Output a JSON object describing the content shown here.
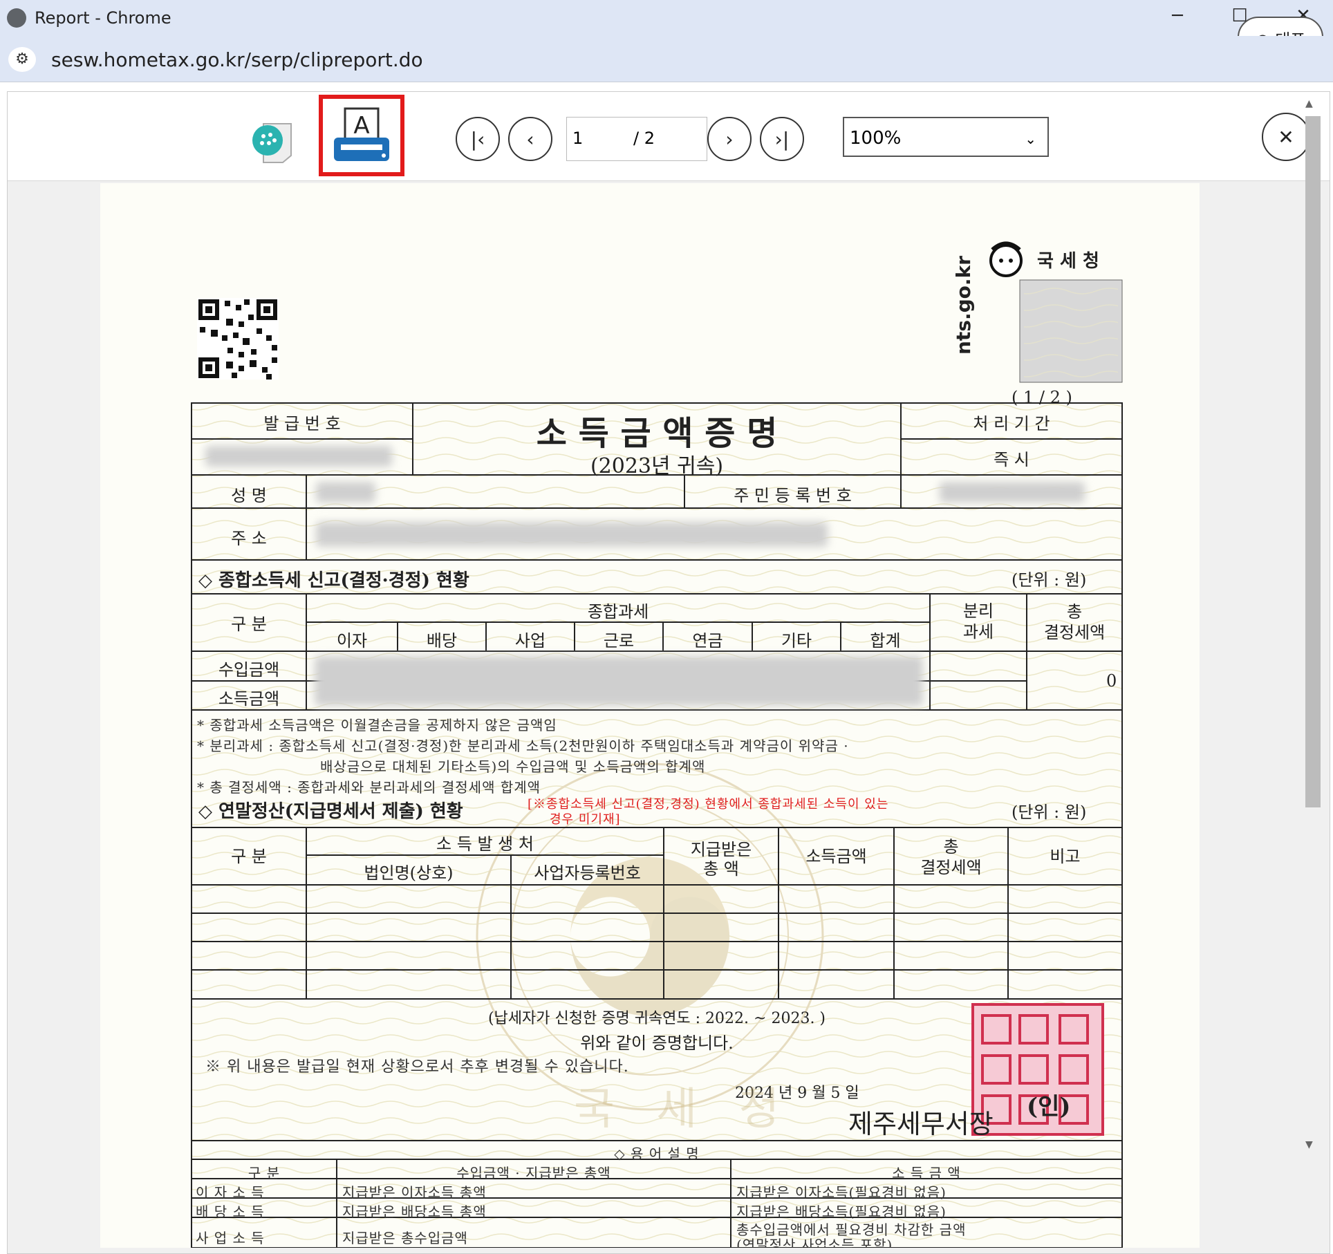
{
  "window": {
    "title": "Report - Chrome",
    "minimize": "─",
    "maximize": "☐",
    "close": "✕"
  },
  "profile_pill": "○ 대표",
  "address": {
    "url": "sesw.hometax.go.kr/serp/clipreport.do",
    "tune_icon": "tune-icon"
  },
  "toolbar": {
    "first": "|‹",
    "prev": "‹",
    "next": "›",
    "last": "›|",
    "page_current": "1",
    "page_total": "/ 2",
    "zoom": "100%",
    "zoom_caret": "⌄",
    "close": "✕"
  },
  "doc": {
    "nts_label": "국 세 청",
    "nts_url": "nts.go.kr",
    "page_indicator": "( 1   /   2 )",
    "issue_no_label": "발 급 번 호",
    "title": "소  득  금  액  증  명",
    "subtitle": "(2023년 귀속)",
    "period_label": "처 리 기 간",
    "period_value": "즉    시",
    "name_label": "성    명",
    "rrn_label": "주 민 등 록 번 호",
    "address_label": "주    소",
    "section1": {
      "title": "◇ 종합소득세 신고(결정·경정) 현황",
      "unit": "(단위 : 원)",
      "col_gubun": "구 분",
      "group_label": "종합과세",
      "sub_cols": [
        "이자",
        "배당",
        "사업",
        "근로",
        "연금",
        "기타",
        "합계"
      ],
      "col_separate": "분리\n과세",
      "col_total_tax_line1": "총",
      "col_total_tax_line2": "결정세액",
      "row1_label": "수입금액",
      "row2_label": "소득금액",
      "total_tax_value": "0",
      "notes": [
        "* 종합과세 소득금액은 이월결손금을 공제하지 않은 금액임",
        "* 분리과세 : 종합소득세 신고(결정·경정)한 분리과세 소득(2천만원이하 주택임대소득과 계약금이 위약금 ·",
        "배상금으로 대체된 기타소득)의 수입금액 및 소득금액의 합계액",
        "* 총 결정세액 : 종합과세와 분리과세의 결정세액 합계액"
      ]
    },
    "section2": {
      "title": "◇ 연말정산(지급명세서 제출) 현황",
      "red_note_line1": "[※종합소득세 신고(결정,경정) 현황에서 종합과세된 소득이 있는",
      "red_note_line2": "경우 미기재]",
      "unit": "(단위 : 원)",
      "col_gubun": "구 분",
      "group_label": "소 득 발 생 처",
      "col_corp": "법인명(상호)",
      "col_bizno": "사업자등록번호",
      "col_paid_line1": "지급받은",
      "col_paid_line2": "총 액",
      "col_income": "소득금액",
      "col_tax_line1": "총",
      "col_tax_line2": "결정세액",
      "col_remark": "비고"
    },
    "cert": {
      "years": "(납세자가 신청한 증명 귀속연도 : 2022. ~ 2023. )",
      "statement": "위와 같이 증명합니다.",
      "caution": "※ 위 내용은 발급일 현재 상황으로서 추후 변경될 수 있습니다.",
      "date": "2024 년   9 월   5 일",
      "office": "제주세무서장",
      "seal_mark": "(인)",
      "watermark": "국 세 청"
    },
    "glossary": {
      "title": "◇ 용 어 설 명",
      "headers": [
        "구 분",
        "수입금액 · 지급받은 총액",
        "소 득 금 액"
      ],
      "rows": [
        [
          "이   자   소   득",
          "지급받은 이자소득 총액",
          "지급받은 이자소득(필요경비 없음)"
        ],
        [
          "배   당   소   득",
          "지급받은 배당소득 총액",
          "지급받은 배당소득(필요경비 없음)"
        ],
        [
          "사   업   소   득",
          "지급받은 총수입금액",
          "총수입금액에서 필요경비 차감한 금액"
        ]
      ],
      "row3_extra": "(연말정산 사업소득 포함)"
    }
  }
}
